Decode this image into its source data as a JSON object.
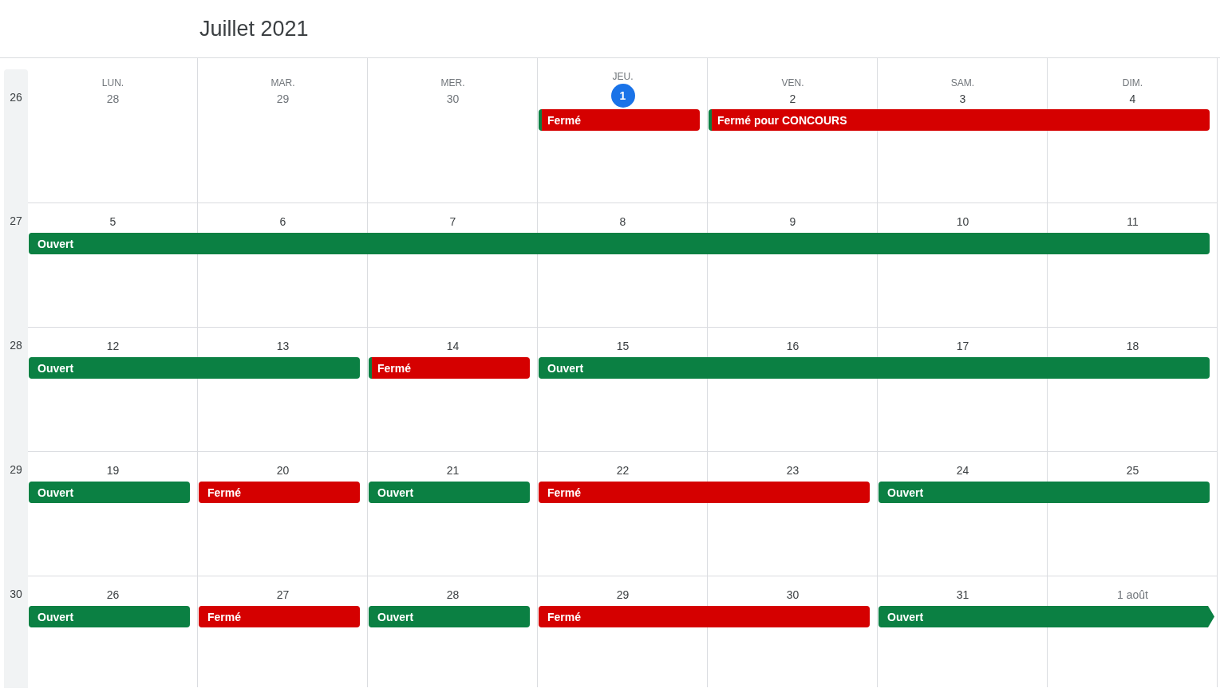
{
  "header": {
    "title": "Juillet 2021"
  },
  "weeks": [
    {
      "number": "26",
      "days": [
        {
          "weekday": "LUN.",
          "date": "28",
          "muted": true,
          "today": false
        },
        {
          "weekday": "MAR.",
          "date": "29",
          "muted": true,
          "today": false
        },
        {
          "weekday": "MER.",
          "date": "30",
          "muted": true,
          "today": false
        },
        {
          "weekday": "JEU.",
          "date": "1",
          "muted": false,
          "today": true,
          "event": {
            "label": "Fermé",
            "color": "#d50000",
            "accent": true,
            "continues": false
          }
        },
        {
          "weekday": "VEN.",
          "date": "2",
          "muted": false,
          "today": false,
          "event": {
            "label": "Fermé pour CONCOURS",
            "color": "#d50000",
            "accent": true,
            "continues": false
          }
        },
        {
          "weekday": "SAM.",
          "date": "3",
          "muted": false,
          "today": false,
          "spanned": true
        },
        {
          "weekday": "DIM.",
          "date": "4",
          "muted": false,
          "today": false,
          "spanned": true
        }
      ]
    },
    {
      "number": "27",
      "days": [
        {
          "date": "5",
          "muted": false,
          "today": false,
          "event": {
            "label": "Ouvert",
            "color": "#0b8043",
            "continues": false
          }
        },
        {
          "date": "6",
          "muted": false,
          "today": false,
          "spanned": true
        },
        {
          "date": "7",
          "muted": false,
          "today": false,
          "spanned": true
        },
        {
          "date": "8",
          "muted": false,
          "today": false,
          "spanned": true
        },
        {
          "date": "9",
          "muted": false,
          "today": false,
          "spanned": true
        },
        {
          "date": "10",
          "muted": false,
          "today": false,
          "spanned": true
        },
        {
          "date": "11",
          "muted": false,
          "today": false,
          "spanned": true
        }
      ]
    },
    {
      "number": "28",
      "days": [
        {
          "date": "12",
          "muted": false,
          "today": false,
          "event": {
            "label": "Ouvert",
            "color": "#0b8043",
            "continues": false
          }
        },
        {
          "date": "13",
          "muted": false,
          "today": false,
          "spanned": true
        },
        {
          "date": "14",
          "muted": false,
          "today": false,
          "event": {
            "label": "Fermé",
            "color": "#d50000",
            "accent": true,
            "continues": false
          }
        },
        {
          "date": "15",
          "muted": false,
          "today": false,
          "event": {
            "label": "Ouvert",
            "color": "#0b8043",
            "continues": false
          }
        },
        {
          "date": "16",
          "muted": false,
          "today": false,
          "spanned": true
        },
        {
          "date": "17",
          "muted": false,
          "today": false,
          "spanned": true
        },
        {
          "date": "18",
          "muted": false,
          "today": false,
          "spanned": true
        }
      ]
    },
    {
      "number": "29",
      "days": [
        {
          "date": "19",
          "muted": false,
          "today": false,
          "event": {
            "label": "Ouvert",
            "color": "#0b8043",
            "continues": false
          }
        },
        {
          "date": "20",
          "muted": false,
          "today": false,
          "event": {
            "label": "Fermé",
            "color": "#d50000",
            "accent": false,
            "continues": false
          }
        },
        {
          "date": "21",
          "muted": false,
          "today": false,
          "event": {
            "label": "Ouvert",
            "color": "#0b8043",
            "continues": false
          }
        },
        {
          "date": "22",
          "muted": false,
          "today": false,
          "event": {
            "label": "Fermé",
            "color": "#d50000",
            "accent": false,
            "continues": false
          }
        },
        {
          "date": "23",
          "muted": false,
          "today": false,
          "spanned": true
        },
        {
          "date": "24",
          "muted": false,
          "today": false,
          "event": {
            "label": "Ouvert",
            "color": "#0b8043",
            "continues": false
          }
        },
        {
          "date": "25",
          "muted": false,
          "today": false,
          "spanned": true
        }
      ]
    },
    {
      "number": "30",
      "days": [
        {
          "date": "26",
          "muted": false,
          "today": false,
          "event": {
            "label": "Ouvert",
            "color": "#0b8043",
            "continues": false
          }
        },
        {
          "date": "27",
          "muted": false,
          "today": false,
          "event": {
            "label": "Fermé",
            "color": "#d50000",
            "accent": false,
            "continues": false
          }
        },
        {
          "date": "28",
          "muted": false,
          "today": false,
          "event": {
            "label": "Ouvert",
            "color": "#0b8043",
            "continues": false
          }
        },
        {
          "date": "29",
          "muted": false,
          "today": false,
          "event": {
            "label": "Fermé",
            "color": "#d50000",
            "accent": false,
            "continues": false
          }
        },
        {
          "date": "30",
          "muted": false,
          "today": false,
          "spanned": true
        },
        {
          "date": "31",
          "muted": false,
          "today": false,
          "event": {
            "label": "Ouvert",
            "color": "#0b8043",
            "continues": true
          }
        },
        {
          "date": "1 août",
          "muted": true,
          "today": false,
          "spanned": true
        }
      ]
    }
  ]
}
